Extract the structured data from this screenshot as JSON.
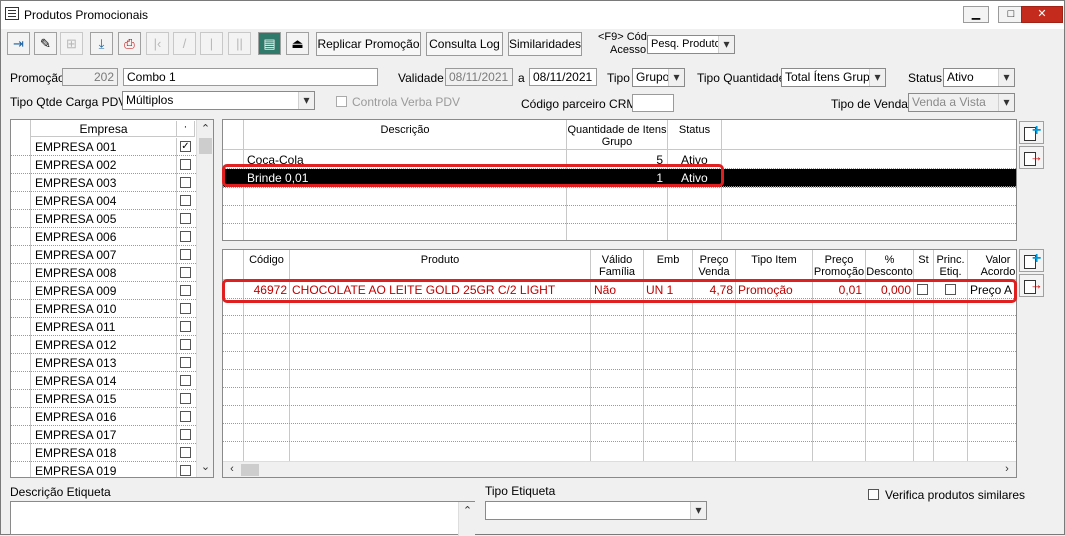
{
  "window": {
    "title": "Produtos Promocionais",
    "minimize": "▁",
    "maximize": "□",
    "close": "✕"
  },
  "toolbar": {
    "icons": [
      "exit-icon",
      "edit-icon",
      "tree-icon",
      "save-icon",
      "print-icon",
      "first-icon",
      "prev-icon",
      "next-icon",
      "last-icon",
      "list-icon",
      "export-icon"
    ],
    "buttons": {
      "replicar": "Replicar Promoção",
      "consulta_log": "Consulta Log",
      "similaridades": "Similaridades"
    },
    "f9_label_line1": "<F9> Cód",
    "f9_label_line2": "Acesso",
    "pesq_select": "Pesq. Produto"
  },
  "form": {
    "promocao_label": "Promoção",
    "promocao_code": "202",
    "promocao_name": "Combo 1",
    "validade_label": "Validade",
    "validade_from": "08/11/2021",
    "validade_a": "a",
    "validade_to": "08/11/2021",
    "tipo_label": "Tipo",
    "tipo_value": "Grupo",
    "tipo_quantidade_label": "Tipo Quantidade",
    "tipo_quantidade_value": "Total Ítens Grupo",
    "status_label": "Status",
    "status_value": "Ativo",
    "tipo_qtde_carga_label": "Tipo Qtde Carga PDV",
    "tipo_qtde_carga_value": "Múltiplos",
    "controla_verba_label": "Controla Verba PDV",
    "codigo_parceiro_label": "Código parceiro CRM",
    "codigo_parceiro_value": "",
    "tipo_venda_label": "Tipo de Venda",
    "tipo_venda_value": "Venda a Vista"
  },
  "empresas": {
    "header": "Empresa",
    "header_check": "·",
    "rows": [
      {
        "name": "EMPRESA 001",
        "checked": true
      },
      {
        "name": "EMPRESA 002",
        "checked": false
      },
      {
        "name": "EMPRESA 003",
        "checked": false
      },
      {
        "name": "EMPRESA 004",
        "checked": false
      },
      {
        "name": "EMPRESA 005",
        "checked": false
      },
      {
        "name": "EMPRESA 006",
        "checked": false
      },
      {
        "name": "EMPRESA 007",
        "checked": false
      },
      {
        "name": "EMPRESA 008",
        "checked": false
      },
      {
        "name": "EMPRESA 009",
        "checked": false
      },
      {
        "name": "EMPRESA 010",
        "checked": false
      },
      {
        "name": "EMPRESA 011",
        "checked": false
      },
      {
        "name": "EMPRESA 012",
        "checked": false
      },
      {
        "name": "EMPRESA 013",
        "checked": false
      },
      {
        "name": "EMPRESA 014",
        "checked": false
      },
      {
        "name": "EMPRESA 015",
        "checked": false
      },
      {
        "name": "EMPRESA 016",
        "checked": false
      },
      {
        "name": "EMPRESA 017",
        "checked": false
      },
      {
        "name": "EMPRESA 018",
        "checked": false
      },
      {
        "name": "EMPRESA 019",
        "checked": false
      }
    ]
  },
  "grupos": {
    "headers": {
      "descricao": "Descrição",
      "quantidade": "Quantidade de Itens Grupo",
      "status": "Status"
    },
    "rows": [
      {
        "descricao": "Coca-Cola",
        "quantidade": "5",
        "status": "Ativo",
        "selected": false
      },
      {
        "descricao": "Brinde 0,01",
        "quantidade": "1",
        "status": "Ativo",
        "selected": true
      }
    ]
  },
  "produtos": {
    "headers": {
      "codigo": "Código",
      "produto": "Produto",
      "valido_familia": "Válido Família",
      "emb": "Emb",
      "preco_venda": "Preço Venda",
      "tipo_item": "Tipo Item",
      "preco_promocao": "Preço Promoção",
      "desconto": "% Desconto",
      "st": "St",
      "princ_etiq": "Princ. Etiq.",
      "valor_acordo": "Valor Acordo"
    },
    "rows": [
      {
        "codigo": "46972",
        "produto": "CHOCOLATE AO LEITE GOLD 25GR C/2 LIGHT",
        "valido_familia": "Não",
        "emb": "UN  1",
        "preco_venda": "4,78",
        "tipo_item": "Promoção",
        "preco_promocao": "0,01",
        "desconto": "0,000",
        "st": false,
        "princ_etiq": false,
        "valor_acordo": "Preço A"
      }
    ],
    "row_color": "#c00000"
  },
  "bottom": {
    "descricao_etiqueta_label": "Descrição Etiqueta",
    "tipo_etiqueta_label": "Tipo Etiqueta",
    "tipo_etiqueta_value": "",
    "verifica_similares_label": "Verifica produtos similares"
  },
  "colors": {
    "highlight": "#e02020",
    "selected_row": "#000000"
  }
}
